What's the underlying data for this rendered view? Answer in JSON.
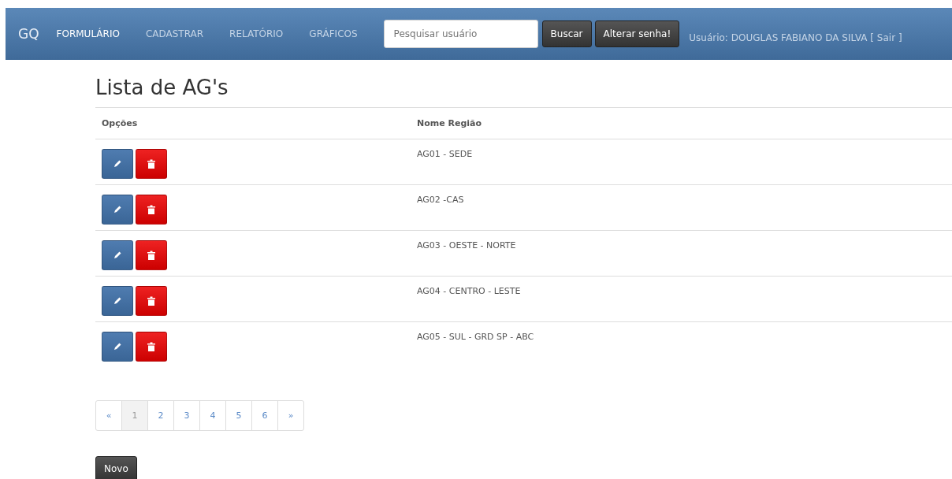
{
  "navbar": {
    "brand": "GQ",
    "items": [
      {
        "label": "FORMULÁRIO",
        "selected": true
      },
      {
        "label": "CADASTRAR",
        "selected": false
      },
      {
        "label": "RELATÓRIO",
        "selected": false
      },
      {
        "label": "GRÁFICOS",
        "selected": false
      }
    ],
    "search": {
      "placeholder": "Pesquisar usuário"
    },
    "buttons": [
      "Buscar",
      "Alterar senha!"
    ],
    "user": "Usuário: DOUGLAS FABIANO DA SILVA [ Sair ]"
  },
  "title": "Lista de AG's",
  "table": {
    "columns": [
      "Opções",
      "Nome Região"
    ],
    "rows": [
      {
        "name": "AG01 - SEDE"
      },
      {
        "name": "AG02 -CAS"
      },
      {
        "name": "AG03 - OESTE - NORTE"
      },
      {
        "name": "AG04 - CENTRO - LESTE"
      },
      {
        "name": "AG05 - SUL - GRD SP - ABC"
      }
    ]
  },
  "pagination": [
    {
      "label": "«",
      "selected": false
    },
    {
      "label": "1",
      "selected": true
    },
    {
      "label": "2",
      "selected": false
    },
    {
      "label": "3",
      "selected": false
    },
    {
      "label": "4",
      "selected": false
    },
    {
      "label": "5",
      "selected": false
    },
    {
      "label": "6",
      "selected": false
    },
    {
      "label": "»",
      "selected": false
    }
  ],
  "new_button": "Novo"
}
